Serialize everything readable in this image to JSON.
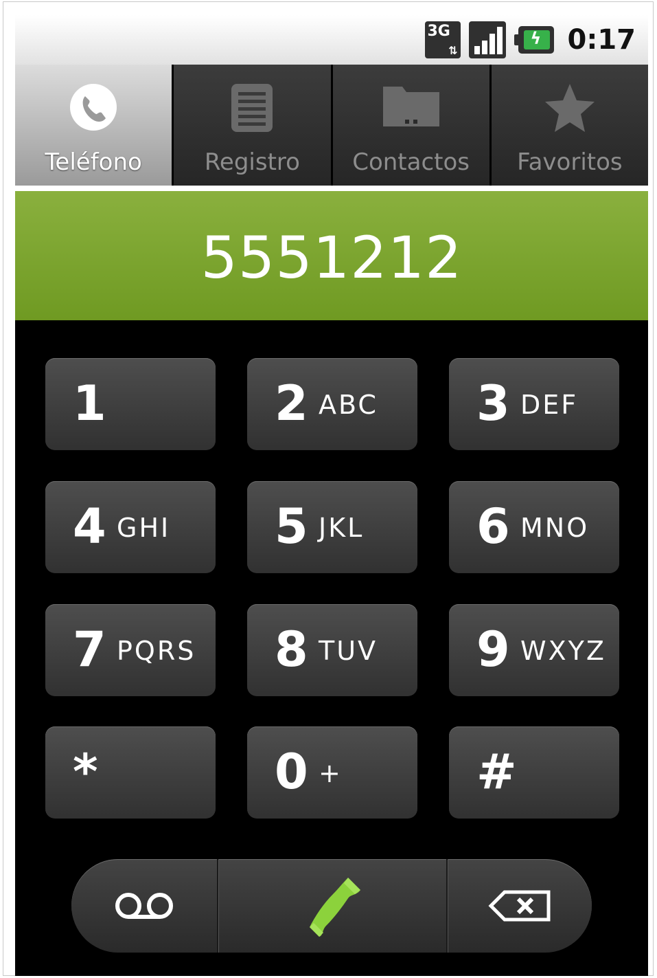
{
  "status_bar": {
    "network_label": "3G",
    "time": "0:17"
  },
  "tabs": [
    {
      "label": "Teléfono",
      "icon": "phone-icon",
      "selected": true
    },
    {
      "label": "Registro",
      "icon": "call-log-icon",
      "selected": false
    },
    {
      "label": "Contactos",
      "icon": "contacts-folder-icon",
      "selected": false
    },
    {
      "label": "Favoritos",
      "icon": "star-icon",
      "selected": false
    }
  ],
  "display": {
    "number": "5551212"
  },
  "keypad": {
    "keys": [
      {
        "digit": "1",
        "letters": ""
      },
      {
        "digit": "2",
        "letters": "ABC"
      },
      {
        "digit": "3",
        "letters": "DEF"
      },
      {
        "digit": "4",
        "letters": "GHI"
      },
      {
        "digit": "5",
        "letters": "JKL"
      },
      {
        "digit": "6",
        "letters": "MNO"
      },
      {
        "digit": "7",
        "letters": "PQRS"
      },
      {
        "digit": "8",
        "letters": "TUV"
      },
      {
        "digit": "9",
        "letters": "WXYZ"
      },
      {
        "digit": "*",
        "letters": ""
      },
      {
        "digit": "0",
        "letters": "+"
      },
      {
        "digit": "#",
        "letters": ""
      }
    ]
  },
  "actions": {
    "voicemail_icon": "voicemail-icon",
    "call_icon": "call-icon",
    "delete_icon": "backspace-icon"
  },
  "colors": {
    "display_green": "#7ba530",
    "call_green": "#8cd23c"
  }
}
